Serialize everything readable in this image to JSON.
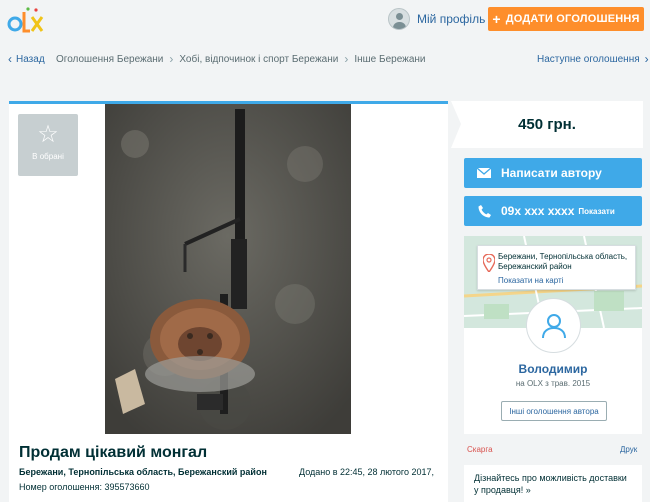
{
  "header": {
    "logo_text": "OLX",
    "profile_label": "Мій профіль",
    "add_button_label": "ДОДАТИ ОГОЛОШЕННЯ"
  },
  "breadcrumbs": {
    "back_label": "Назад",
    "items": [
      "Оголошення Бережани",
      "Хобі, відпочинок і спорт Бережани",
      "Інше Бережани"
    ],
    "next_label": "Наступне оголошення"
  },
  "listing": {
    "favorite_label": "В обрані",
    "title": "Продам цікавий монгал",
    "location": "Бережани, Тернопільська область, Бережанский район",
    "added": "Додано в 22:45, 28 лютого 2017,",
    "ad_number": "Номер оголошення: 395573660"
  },
  "sidebar": {
    "price": "450 грн.",
    "write_button_label": "Написати автору",
    "phone_number": "09х ххх хххх",
    "phone_show_label": "Показати",
    "map_address": "Бережани, Тернопільська область, Бережанский район",
    "show_map_label": "Показати на карті",
    "user_name": "Володимир",
    "user_since": "на OLX з трав. 2015",
    "other_ads_label": "Інші оголошення автора",
    "complain_label": "Скарга",
    "print_label": "Друк",
    "delivery_text": "Дізнайтесь про можливість доставки у продавця! »"
  },
  "colors": {
    "accent_blue": "#3fa9e8",
    "orange": "#fe8e2b",
    "link": "#2c67a0"
  }
}
